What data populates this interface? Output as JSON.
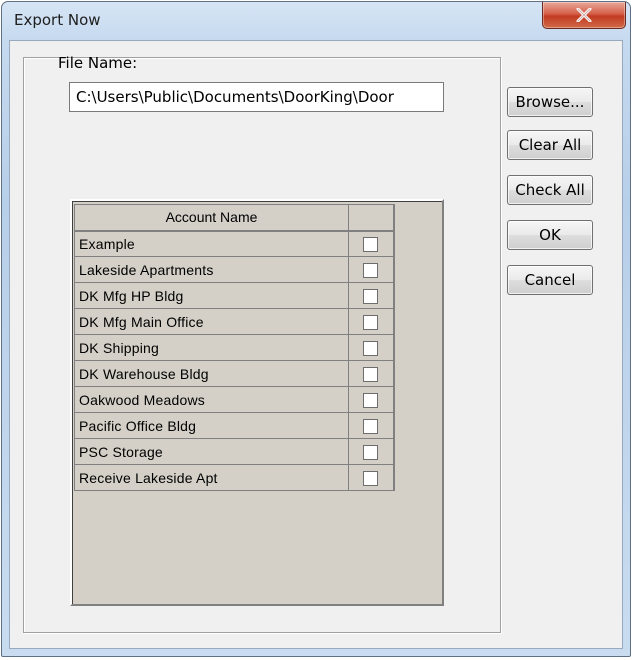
{
  "window": {
    "title": "Export Now"
  },
  "file": {
    "label": "File Name:",
    "value": "C:\\Users\\Public\\Documents\\DoorKing\\Door"
  },
  "grid": {
    "header": "Account Name",
    "rows": [
      {
        "name": "Example",
        "checked": false
      },
      {
        "name": "Lakeside Apartments",
        "checked": false
      },
      {
        "name": "DK Mfg HP Bldg",
        "checked": false
      },
      {
        "name": "DK Mfg Main Office",
        "checked": false
      },
      {
        "name": "DK Shipping",
        "checked": false
      },
      {
        "name": "DK Warehouse Bldg",
        "checked": false
      },
      {
        "name": "Oakwood Meadows",
        "checked": false
      },
      {
        "name": "Pacific Office Bldg",
        "checked": false
      },
      {
        "name": "PSC Storage",
        "checked": false
      },
      {
        "name": "Receive Lakeside Apt",
        "checked": false
      }
    ]
  },
  "buttons": {
    "browse": "Browse...",
    "clear_all": "Clear All",
    "check_all": "Check All",
    "ok": "OK",
    "cancel": "Cancel"
  },
  "icons": {
    "close": "close-icon"
  },
  "colors": {
    "close_button": "#c94a32",
    "grid_background": "#d4d0c8"
  }
}
